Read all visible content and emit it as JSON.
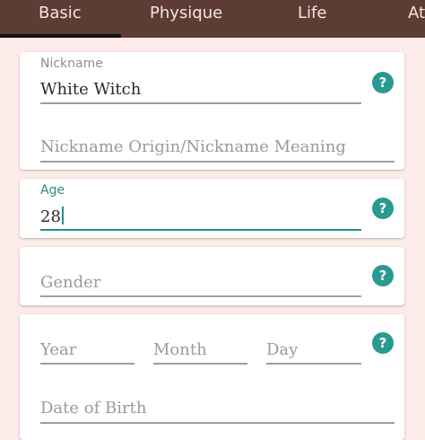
{
  "tabs": [
    {
      "label": "Basic"
    },
    {
      "label": "Physique"
    },
    {
      "label": "Life"
    },
    {
      "label": "At"
    }
  ],
  "nickname": {
    "label": "Nickname",
    "value": "White Witch",
    "origin_placeholder": "Nickname Origin/Nickname Meaning"
  },
  "age": {
    "label": "Age",
    "value": "28"
  },
  "gender": {
    "placeholder": "Gender"
  },
  "birth": {
    "year_placeholder": "Year",
    "month_placeholder": "Month",
    "day_placeholder": "Day",
    "date_placeholder": "Date of Birth"
  },
  "help": {
    "glyph": "?"
  },
  "colors": {
    "header": "#5d3c34",
    "accent": "#2a998f",
    "background": "#fcebe8"
  }
}
